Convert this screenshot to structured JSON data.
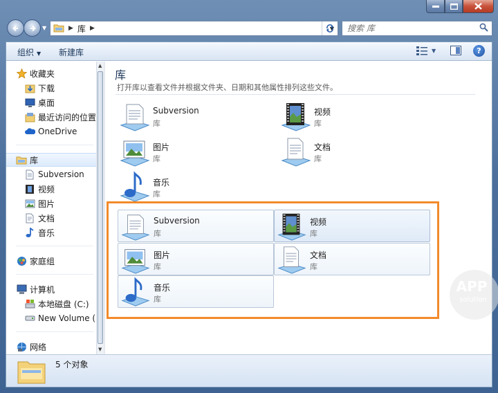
{
  "address": {
    "crumbs": [
      "库"
    ]
  },
  "search": {
    "placeholder": "搜索 库"
  },
  "toolbar": {
    "organize_label": "组织",
    "new_library_label": "新建库"
  },
  "navpane": {
    "favorites": {
      "label": "收藏夹",
      "items": [
        "下载",
        "桌面",
        "最近访问的位置",
        "OneDrive"
      ]
    },
    "libraries": {
      "label": "库",
      "items": [
        "Subversion",
        "视频",
        "图片",
        "文档",
        "音乐"
      ]
    },
    "homegroup": {
      "label": "家庭组"
    },
    "computer": {
      "label": "计算机",
      "items": [
        "本地磁盘 (C:)",
        "New Volume (D"
      ]
    },
    "network": {
      "label": "网络"
    }
  },
  "content": {
    "title": "库",
    "subtitle": "打开库以查看文件并根据文件夹、日期和其他属性排列这些文件。",
    "libraries": [
      {
        "name": "Subversion",
        "type": "库",
        "icon": "subversion-library-icon"
      },
      {
        "name": "视频",
        "type": "库",
        "icon": "videos-library-icon"
      },
      {
        "name": "图片",
        "type": "库",
        "icon": "pictures-library-icon"
      },
      {
        "name": "文档",
        "type": "库",
        "icon": "documents-library-icon"
      },
      {
        "name": "音乐",
        "type": "库",
        "icon": "music-library-icon"
      }
    ]
  },
  "watermark": {
    "text": "APP",
    "sub": "solution"
  },
  "status": {
    "count_text": "5 个对象"
  },
  "colors": {
    "highlight_border": "#f28a2a",
    "link_blue": "#1e395b",
    "frame": "#4c6f9c"
  }
}
